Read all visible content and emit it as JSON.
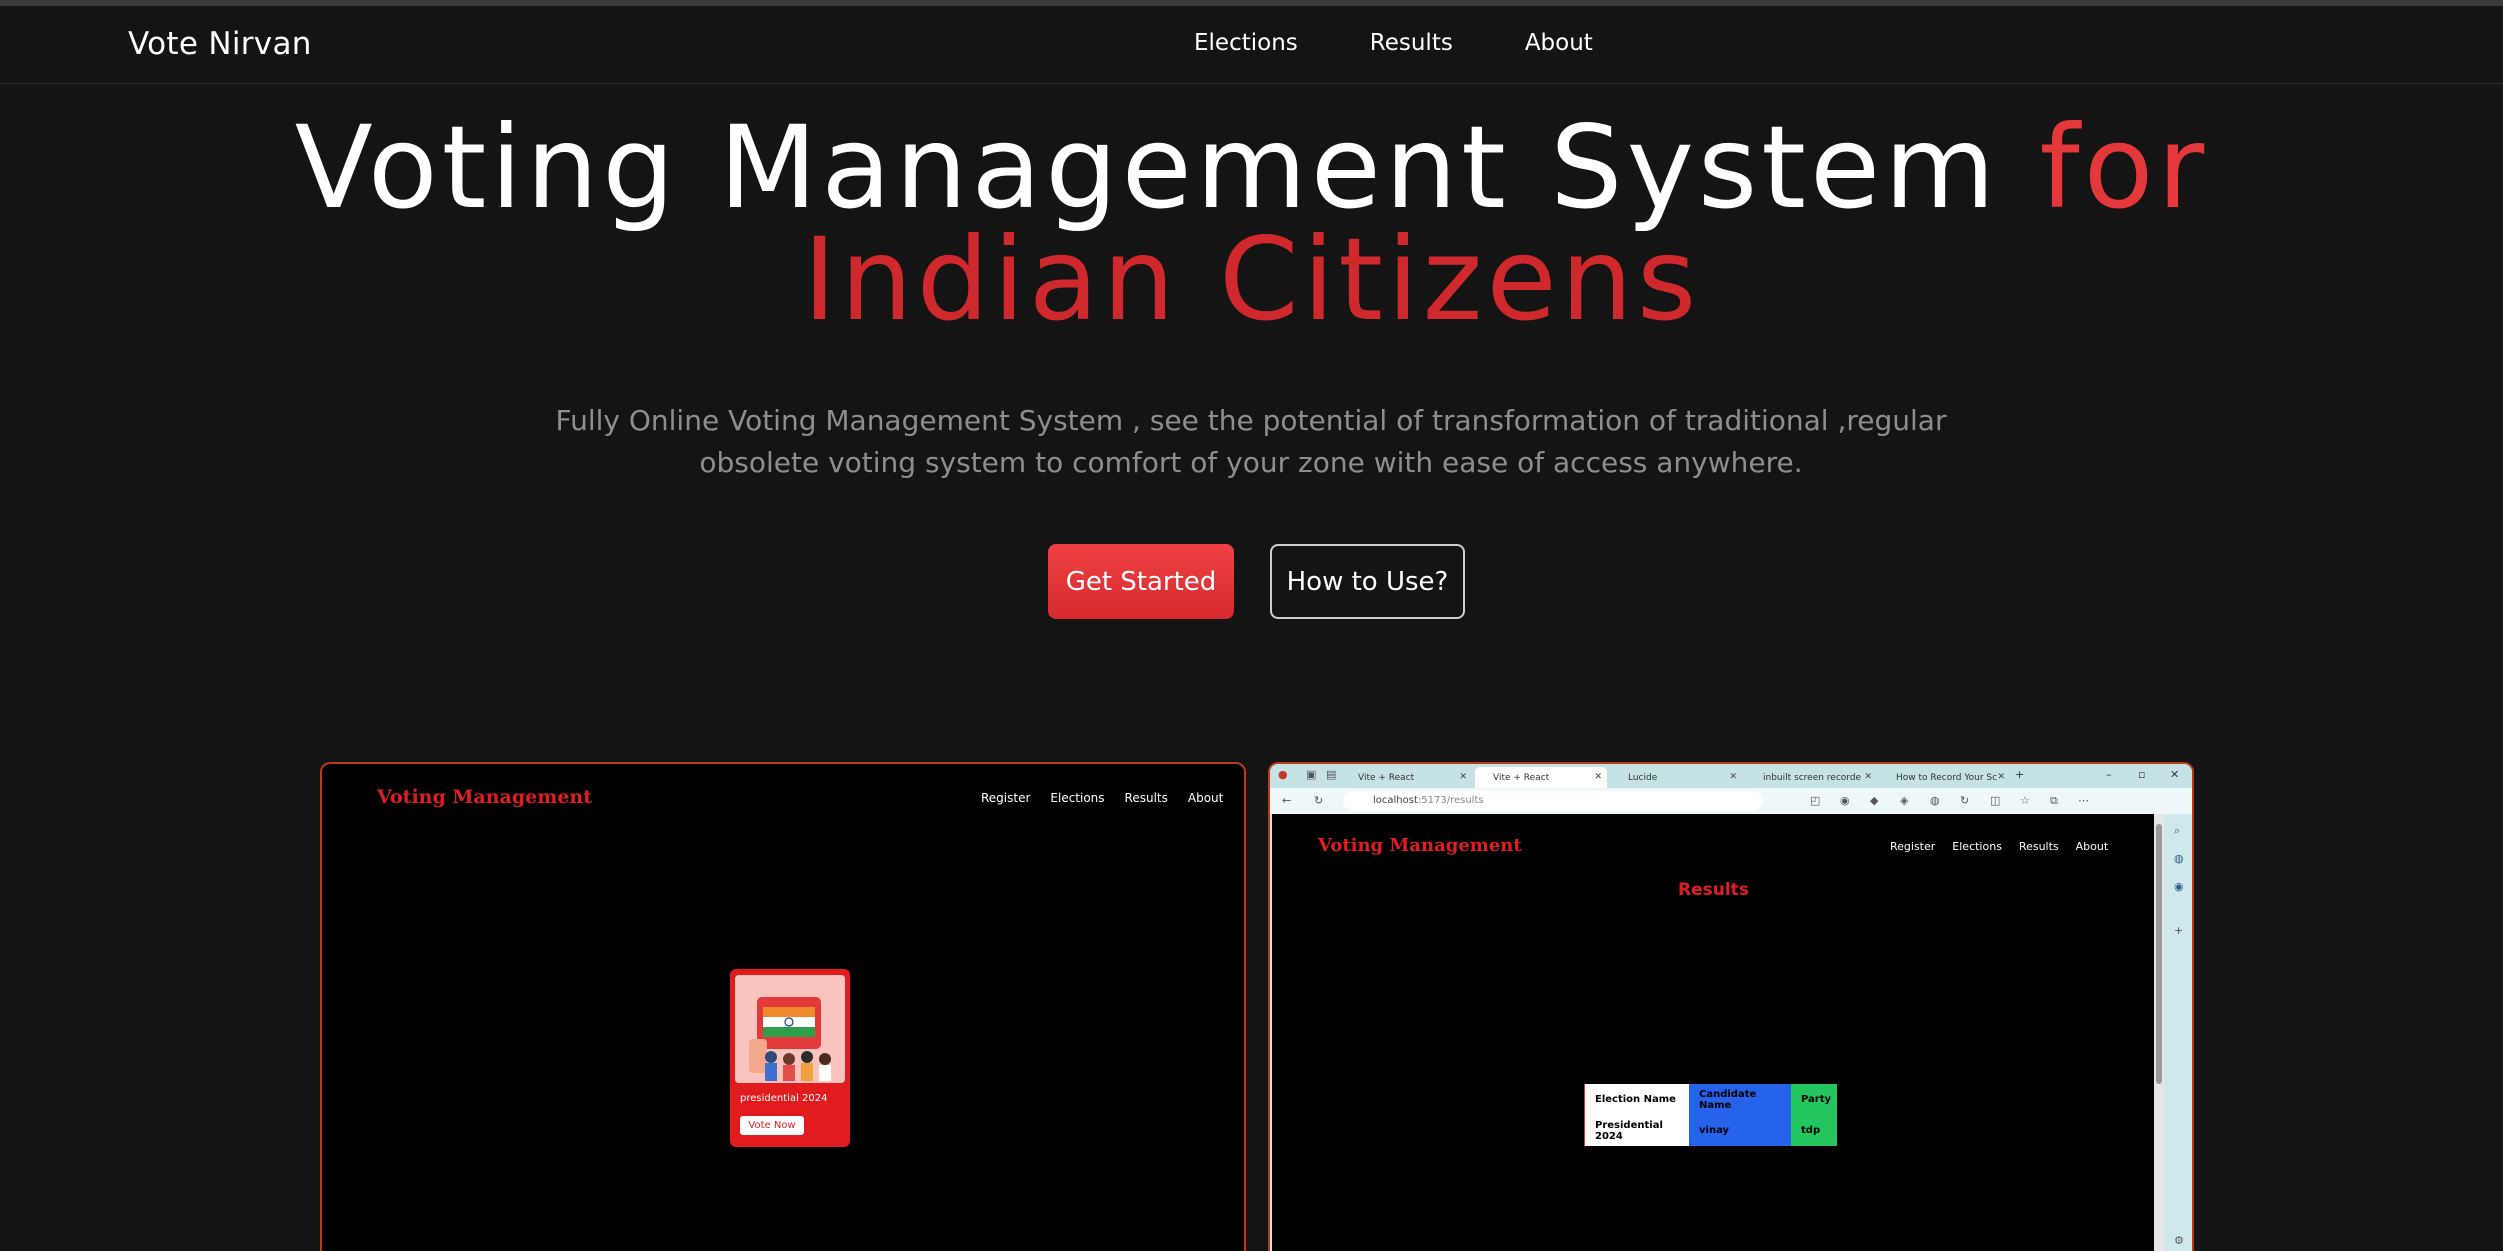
{
  "nav": {
    "brand": "Vote Nirvan",
    "links": [
      "Elections",
      "Results",
      "About"
    ]
  },
  "hero": {
    "title_white": "Voting Management System",
    "title_red_1": "for",
    "title_red_2": "Indian Citizens",
    "description": "Fully Online Voting Management System , see the potential of transformation of traditional ,regular obsolete voting system to comfort of your zone with ease of access anywhere.",
    "primary_button": "Get Started",
    "secondary_button": "How to Use?"
  },
  "colors": {
    "accent": "#e5383b",
    "background": "#141414"
  },
  "preview_left": {
    "logo": "Voting Management",
    "nav": [
      "Register",
      "Elections",
      "Results",
      "About"
    ],
    "card_label": "presidential 2024",
    "card_button": "Vote Now"
  },
  "preview_right": {
    "tabs": [
      "Vite + React",
      "Vite + React",
      "Lucide",
      "inbuilt screen recorde",
      "How to Record Your Sc"
    ],
    "url_host": "localhost",
    "url_path": ":5173/results",
    "logo": "Voting Management",
    "nav": [
      "Register",
      "Elections",
      "Results",
      "About"
    ],
    "page_title": "Results",
    "table": {
      "headers": [
        "Election Name",
        "Candidate Name",
        "Party"
      ],
      "rows": [
        [
          "Presidential 2024",
          "vinay",
          "tdp"
        ]
      ]
    }
  }
}
